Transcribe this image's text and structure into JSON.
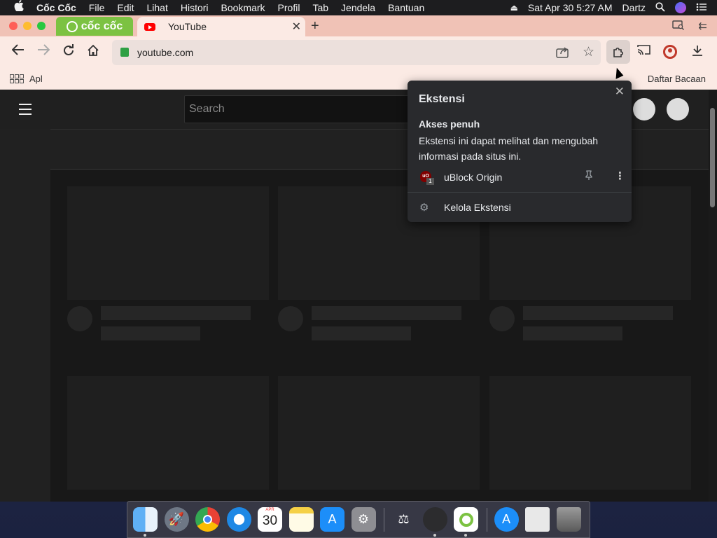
{
  "menubar": {
    "apple_icon": "apple-icon",
    "app_name": "Cốc Cốc",
    "items": [
      "File",
      "Edit",
      "Lihat",
      "Histori",
      "Bookmark",
      "Profil",
      "Tab",
      "Jendela",
      "Bantuan"
    ],
    "datetime": "Sat Apr 30  5:27 AM",
    "user": "Dartz"
  },
  "tabstrip": {
    "brand_label": "cốc cốc",
    "tab_title": "YouTube",
    "new_tab": "+",
    "close_tab": "✕"
  },
  "toolbar": {
    "url": "youtube.com"
  },
  "bookmarks": {
    "apps_label": "Apl",
    "reading_list": "Daftar Bacaan"
  },
  "youtube": {
    "search_placeholder": "Search"
  },
  "extensions_popup": {
    "title": "Ekstensi",
    "section_heading": "Akses penuh",
    "section_description": "Ekstensi ini dapat melihat dan mengubah informasi pada situs ini.",
    "extensions": [
      {
        "name": "uBlock Origin",
        "icon_text": "uO",
        "badge": "1"
      }
    ],
    "manage_label": "Kelola Ekstensi"
  },
  "dock": {
    "calendar_month": "APR",
    "calendar_day": "30",
    "apps": [
      "Finder",
      "Launchpad",
      "Google Chrome",
      "Safari",
      "Calendar",
      "Notes",
      "App Store",
      "System Preferences",
      "Instruments",
      "Digital Color Meter",
      "Cốc Cốc",
      "App Store Downloads",
      "Document",
      "Trash"
    ]
  },
  "colors": {
    "tab_strip": "#f0c2b6",
    "toolbar": "#fbeae4",
    "coccoc_green": "#7cc242",
    "youtube_red": "#ff0000",
    "popup_bg": "#292a2d",
    "page_bg": "#212121"
  }
}
